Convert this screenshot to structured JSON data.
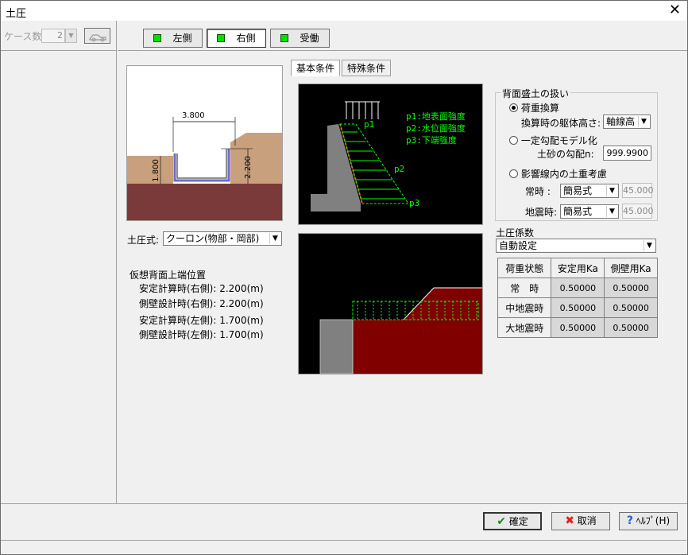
{
  "window": {
    "title": "土圧",
    "close_symbol": "✕"
  },
  "left": {
    "case_label": "ケース数:",
    "case_value": "2",
    "spin_arrow": "▼"
  },
  "side_buttons": [
    "左側",
    "右側",
    "受働"
  ],
  "tabs": [
    "基本条件",
    "特殊条件"
  ],
  "section_drawing": {
    "dim_width": "3.800",
    "dim_left": "1.800",
    "dim_right": "2.200"
  },
  "earth_pressure_formula": {
    "label": "土圧式:",
    "value": "クーロン(物部・岡部)"
  },
  "virtual_top": {
    "title": "仮想背面上端位置",
    "rows": [
      "安定計算時(右側): 2.200(m)",
      "側壁設計時(右側): 2.200(m)",
      "安定計算時(左側): 1.700(m)",
      "側壁設計時(左側): 1.700(m)"
    ]
  },
  "pressure_diagram": {
    "legend": [
      "p1:地表面強度",
      "p2:水位面強度",
      "p3:下端強度"
    ],
    "labels": [
      "p1",
      "p2",
      "p3"
    ]
  },
  "backfill": {
    "title": "背面盛土の扱い",
    "options": [
      "荷重換算",
      "一定勾配モデル化",
      "影響線内の土重考慮"
    ],
    "selected": 0,
    "height_label": "換算時の躯体高さ:",
    "height_value": "軸線高",
    "slope_label": "土砂の勾配n:",
    "slope_value": "999.9900",
    "normal_label": "常時  :",
    "normal_value": "簡易式",
    "normal_num": "45.000",
    "quake_label": "地震時:",
    "quake_value": "簡易式",
    "quake_num": "45.000"
  },
  "coef": {
    "title": "土圧係数",
    "mode": "自動設定",
    "headers": [
      "荷重状態",
      "安定用Ka",
      "側壁用Ka"
    ],
    "rows": [
      [
        "常　時",
        "0.50000",
        "0.50000"
      ],
      [
        "中地震時",
        "0.50000",
        "0.50000"
      ],
      [
        "大地震時",
        "0.50000",
        "0.50000"
      ]
    ]
  },
  "footer": {
    "ok": "確定",
    "cancel": "取消",
    "help": "ﾍﾙﾌﾟ(H)"
  },
  "colors": {
    "soil": "#c8a07e",
    "ground": "#7a3a3a",
    "pressure_green": "#00ff00",
    "pressure_red": "#ff3030"
  }
}
